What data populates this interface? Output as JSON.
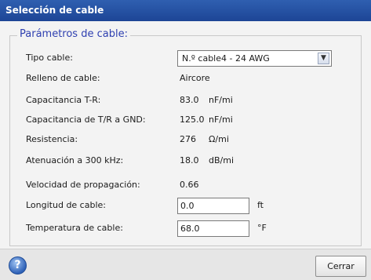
{
  "dialog": {
    "title": "Selección de cable"
  },
  "group": {
    "legend": "Parámetros de cable:"
  },
  "fields": {
    "cable_type": {
      "label": "Tipo cable:",
      "value": "N.º cable4 - 24 AWG"
    },
    "fill": {
      "label": "Relleno de cable:",
      "value": "Aircore"
    },
    "cap_tr": {
      "label": "Capacitancia T-R:",
      "value": "83.0",
      "unit": "nF/mi"
    },
    "cap_gnd": {
      "label": "Capacitancia de T/R a GND:",
      "value": "125.0",
      "unit": "nF/mi"
    },
    "resistance": {
      "label": "Resistencia:",
      "value": "276",
      "unit": "Ω/mi"
    },
    "attenuation": {
      "label": "Atenuación a 300 kHz:",
      "value": "18.0",
      "unit": "dB/mi"
    },
    "velocity": {
      "label": "Velocidad de propagación:",
      "value": "0.66"
    },
    "length": {
      "label": "Longitud de cable:",
      "value": "0.0",
      "unit": "ft"
    },
    "temperature": {
      "label": "Temperatura de cable:",
      "value": "68.0",
      "unit": "°F"
    }
  },
  "footer": {
    "close_label": "Cerrar",
    "help_glyph": "?"
  },
  "icons": {
    "help": "help-icon",
    "dropdown": "chevron-down-icon"
  }
}
